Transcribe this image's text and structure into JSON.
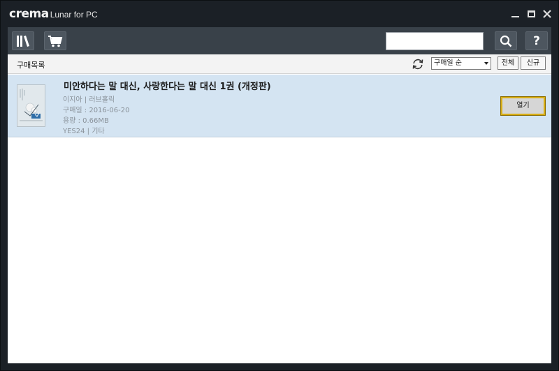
{
  "app": {
    "brand_main": "crema",
    "brand_sub": "Lunar for PC"
  },
  "window_controls": [
    "minimize",
    "maximize",
    "close"
  ],
  "toolbar": {
    "library_icon": "library-icon",
    "cart_icon": "cart-icon",
    "search_value": "",
    "search_icon": "search-icon",
    "help_label": "?"
  },
  "list_header": {
    "title": "구매목록",
    "sort_selected": "구매일 순",
    "filter_all": "전체",
    "filter_new": "신규"
  },
  "books": [
    {
      "title": "미안하다는 말 대신, 사랑한다는 말 대신 1권 (개정판)",
      "author_line": "이지아  | 러브홀릭",
      "purchase_line": "구매일 : 2016-06-20",
      "size_line": "용량  : 0.66MB",
      "store_line": "YES24 | 기타",
      "open_label": "열기"
    }
  ],
  "colors": {
    "frame": "#1b2026",
    "toolbar": "#394149",
    "selected_row": "#d4e4f2",
    "open_button_border": "#d7ad14"
  }
}
